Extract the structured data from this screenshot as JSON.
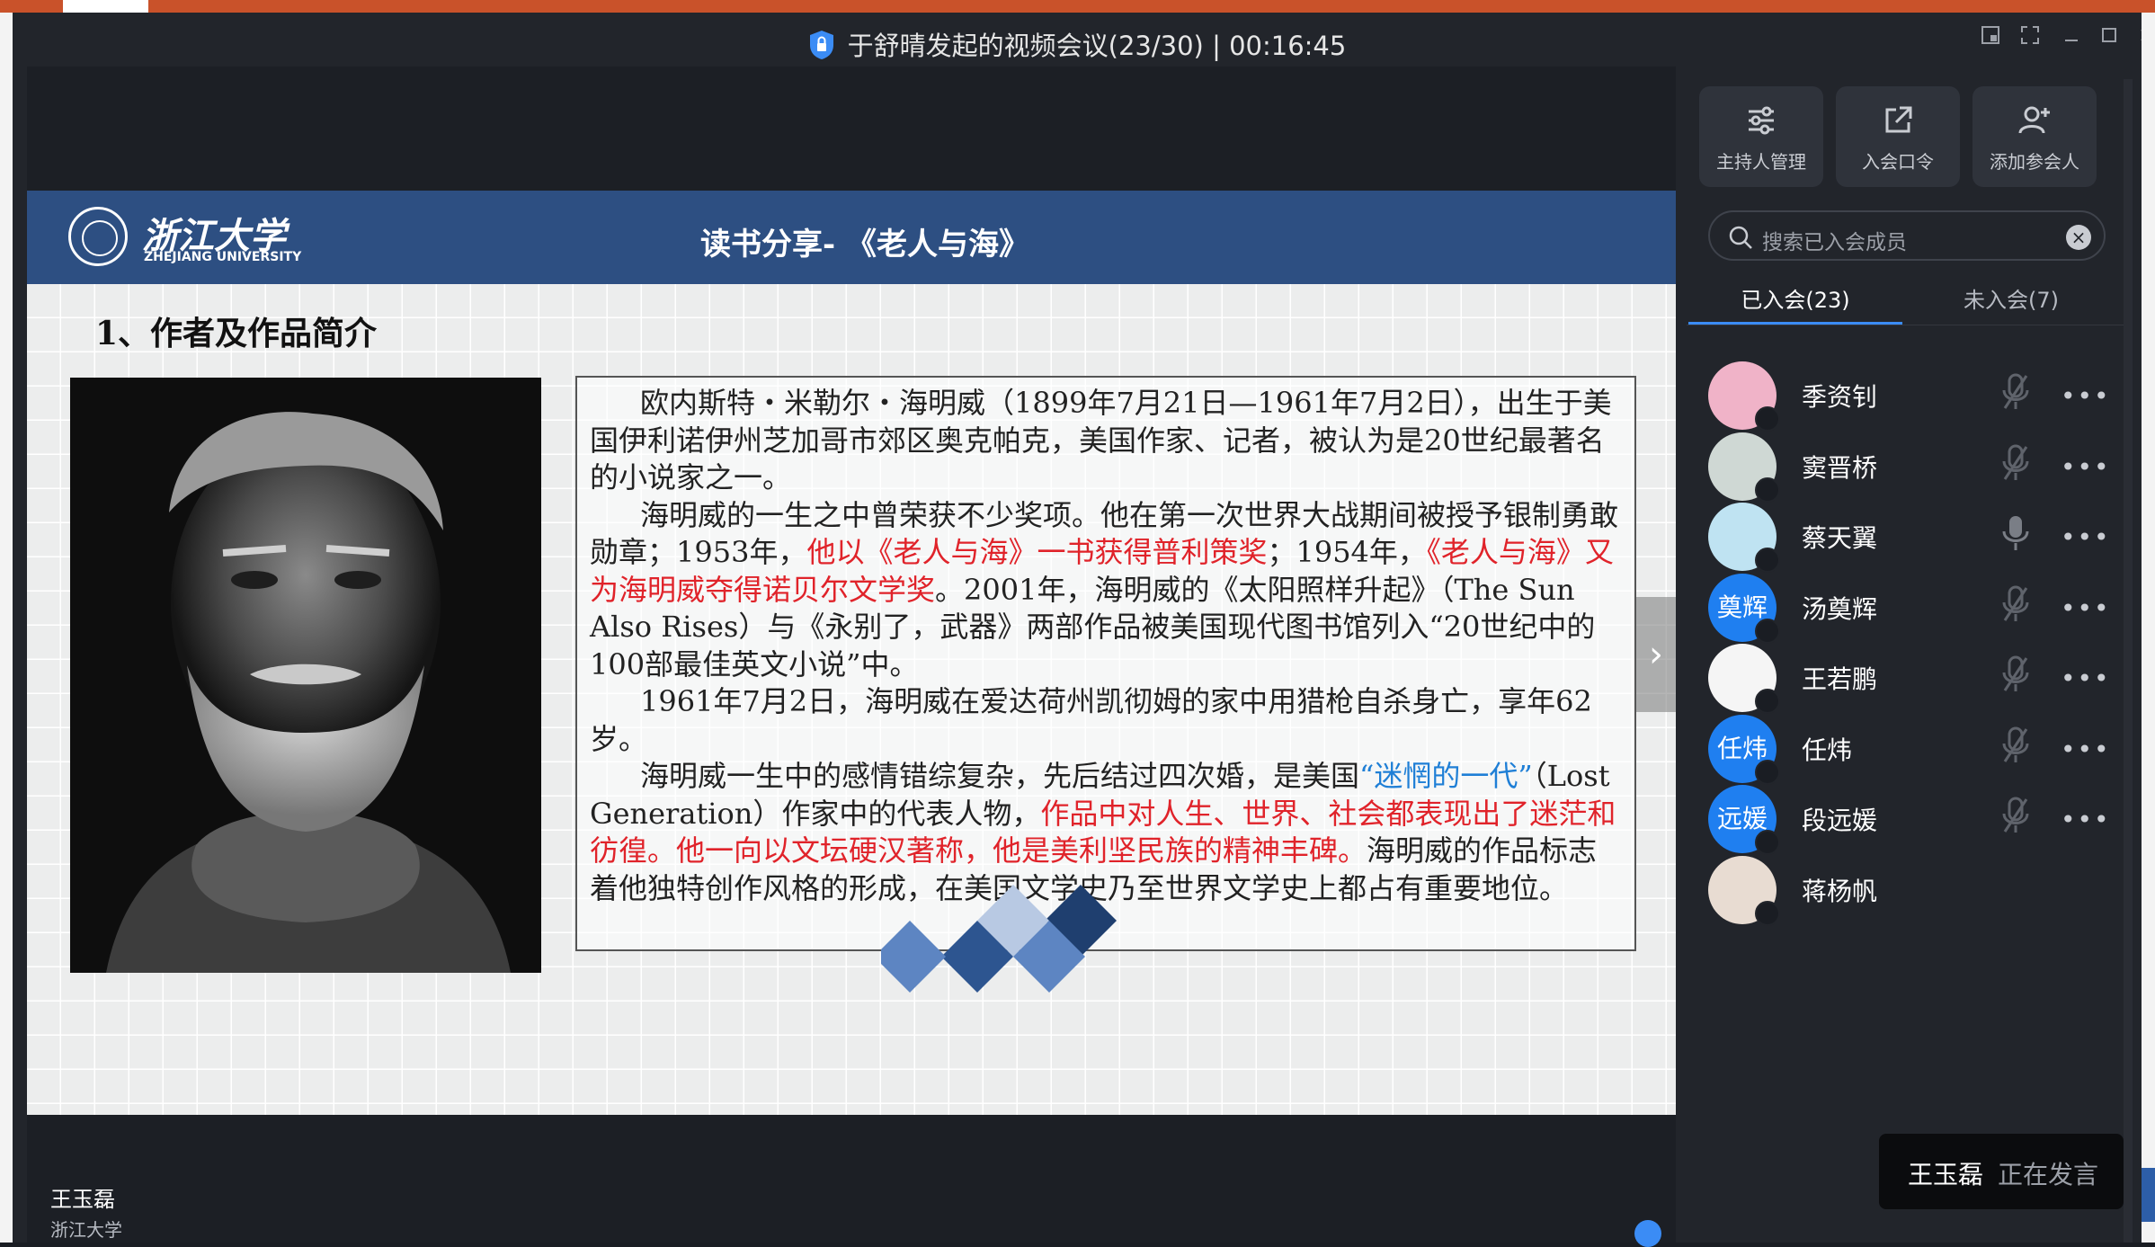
{
  "window": {
    "title": "于舒晴发起的视频会议(23/30) | 00:16:45"
  },
  "slide": {
    "university_cn": "浙江大学",
    "university_en": "ZHEJIANG UNIVERSITY",
    "title": "读书分享- 《老人与海》",
    "section": "1、作者及作品简介",
    "p1": "欧内斯特・米勒尔・海明威（1899年7月21日—1961年7月2日），出生于美国伊利诺伊州芝加哥市郊区奥克帕克，美国作家、记者，被认为是20世纪最著名的小说家之一。",
    "p2_a": "海明威的一生之中曾荣获不少奖项。他在第一次世界大战期间被授予银制勇敢勋章；1953年，",
    "p2_red1": "他以《老人与海》一书获得普利策奖",
    "p2_b": "；1954年，",
    "p2_red2": "《老人与海》又为海明威夺得诺贝尔文学奖",
    "p2_c": "。2001年，海明威的《太阳照样升起》（The Sun Also Rises）与《永别了，武器》两部作品被美国现代图书馆列入“20世纪中的100部最佳英文小说”中。",
    "p3": "1961年7月2日，海明威在爱达荷州凯彻姆的家中用猎枪自杀身亡，享年62岁。",
    "p4_a": "海明威一生中的感情错综复杂，先后结过四次婚，是美国",
    "p4_blue": "“迷惘的一代”",
    "p4_b": "（Lost Generation）作家中的代表人物，",
    "p4_red": "作品中对人生、世界、社会都表现出了迷茫和彷徨。他一向以文坛硬汉著称，他是美利坚民族的精神丰碑。",
    "p4_c": "海明威的作品标志着他独特创作风格的形成，在美国文学史乃至世界文学史上都占有重要地位。"
  },
  "speaker": {
    "name": "王玉磊",
    "org": "浙江大学"
  },
  "panel": {
    "tools": [
      {
        "label": "主持人管理",
        "icon": "sliders-icon"
      },
      {
        "label": "入会口令",
        "icon": "share-link-icon"
      },
      {
        "label": "添加参会人",
        "icon": "add-user-icon"
      }
    ],
    "search_placeholder": "搜索已入会成员",
    "tab_joined": "已入会(23)",
    "tab_not_joined": "未入会(7)",
    "participants": [
      {
        "name": "季资钊",
        "avatar_text": "",
        "avatar_color": "#f0b3c8"
      },
      {
        "name": "窦晋桥",
        "avatar_text": "",
        "avatar_color": "#cfd8d4"
      },
      {
        "name": "蔡天翼",
        "avatar_text": "",
        "avatar_color": "#bfe3f2"
      },
      {
        "name": "汤奠辉",
        "avatar_text": "奠辉",
        "avatar_color": "#1f7ff0"
      },
      {
        "name": "王若鹏",
        "avatar_text": "",
        "avatar_color": "#f5f5f5"
      },
      {
        "name": "任炜",
        "avatar_text": "任炜",
        "avatar_color": "#1f7ff0"
      },
      {
        "name": "段远媛",
        "avatar_text": "远媛",
        "avatar_color": "#1f7ff0"
      },
      {
        "name": "蒋杨帆",
        "avatar_text": "",
        "avatar_color": "#e8dcd2"
      }
    ],
    "more_label": "•••",
    "toast_name": "王玉磊",
    "toast_status": "正在发言"
  }
}
